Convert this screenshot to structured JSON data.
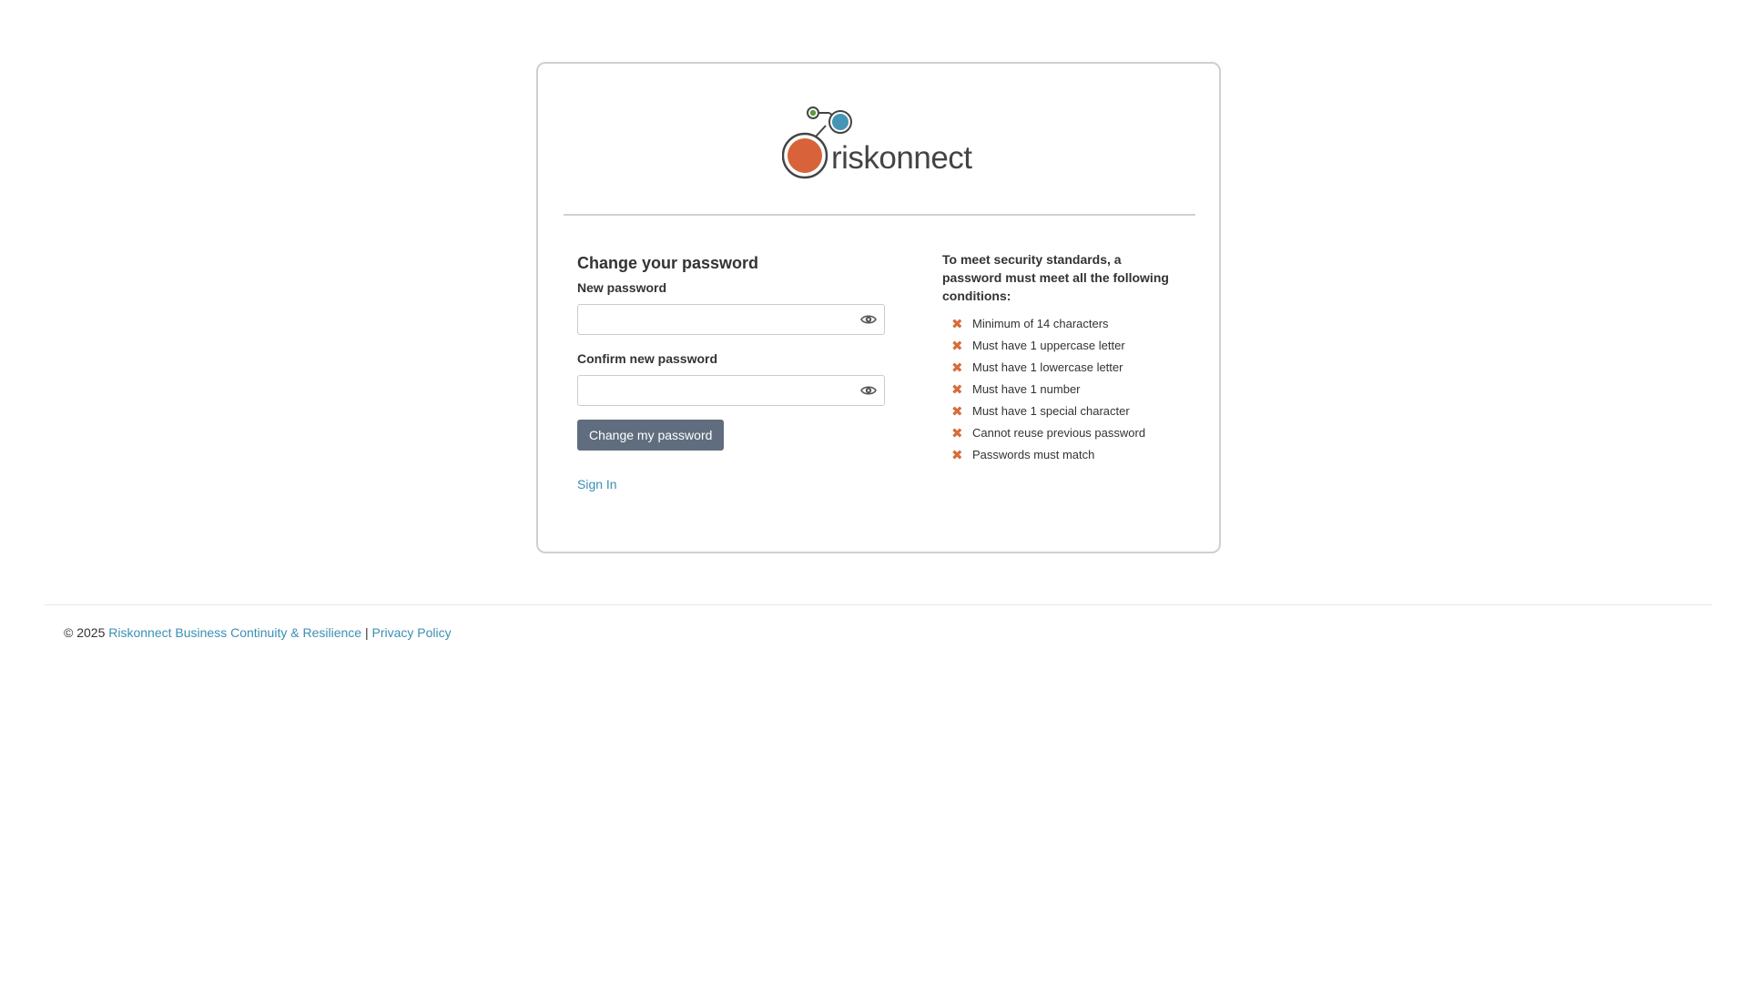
{
  "brand": {
    "name": "riskonnect",
    "colors": {
      "orange": "#d8633a",
      "teal": "#4596b4",
      "green": "#5a9b3e",
      "dark": "#444444"
    }
  },
  "form": {
    "title": "Change your password",
    "new_password_label": "New password",
    "confirm_password_label": "Confirm new password",
    "new_password_value": "",
    "confirm_password_value": "",
    "submit_label": "Change my password",
    "signin_label": "Sign In",
    "toggle_icon": "eye-icon"
  },
  "requirements": {
    "title": "To meet security standards, a password must meet all the following conditions:",
    "status_icon": "x-icon",
    "status_color": "#d86c3b",
    "items": [
      "Minimum of 14 characters",
      "Must have 1 uppercase letter",
      "Must have 1 lowercase letter",
      "Must have 1 number",
      "Must have 1 special character",
      "Cannot reuse previous password",
      "Passwords must match"
    ]
  },
  "footer": {
    "copyright": "© 2025",
    "company_link": "Riskonnect Business Continuity & Resilience",
    "separator": "|",
    "privacy_link": "Privacy Policy"
  },
  "colors": {
    "link": "#3a8fb3",
    "button_bg": "#5f6d7e",
    "card_border": "#cfcfcf"
  }
}
